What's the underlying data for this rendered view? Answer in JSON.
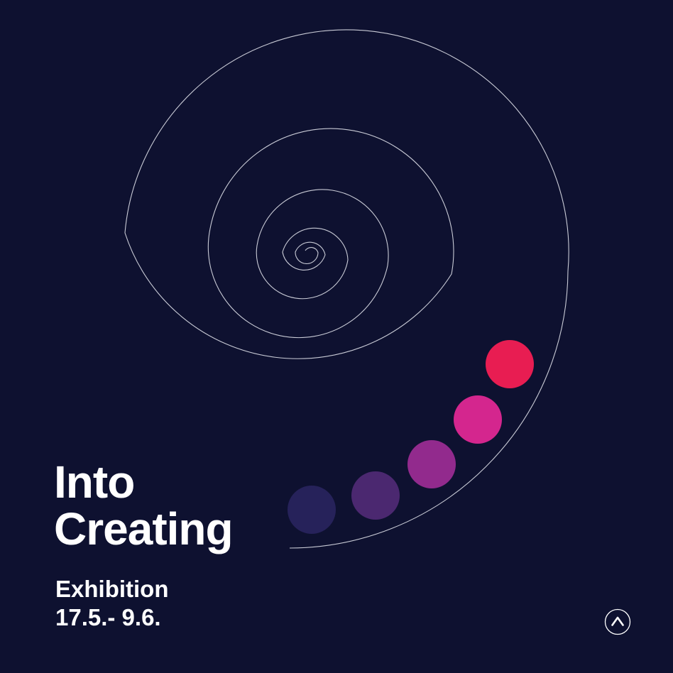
{
  "poster": {
    "title_line1": "Into",
    "title_line2": "Creating",
    "subtitle": "Exhibition",
    "dates": "17.5.- 9.6."
  },
  "colors": {
    "background": "#0e1130",
    "spiral_stroke": "#c9cbd6",
    "text": "#ffffff",
    "dots": [
      "#e81d52",
      "#d4268e",
      "#922a8d",
      "#4b2870",
      "#26225a"
    ]
  },
  "icons": {
    "logo": "caret-up-circle-icon"
  }
}
